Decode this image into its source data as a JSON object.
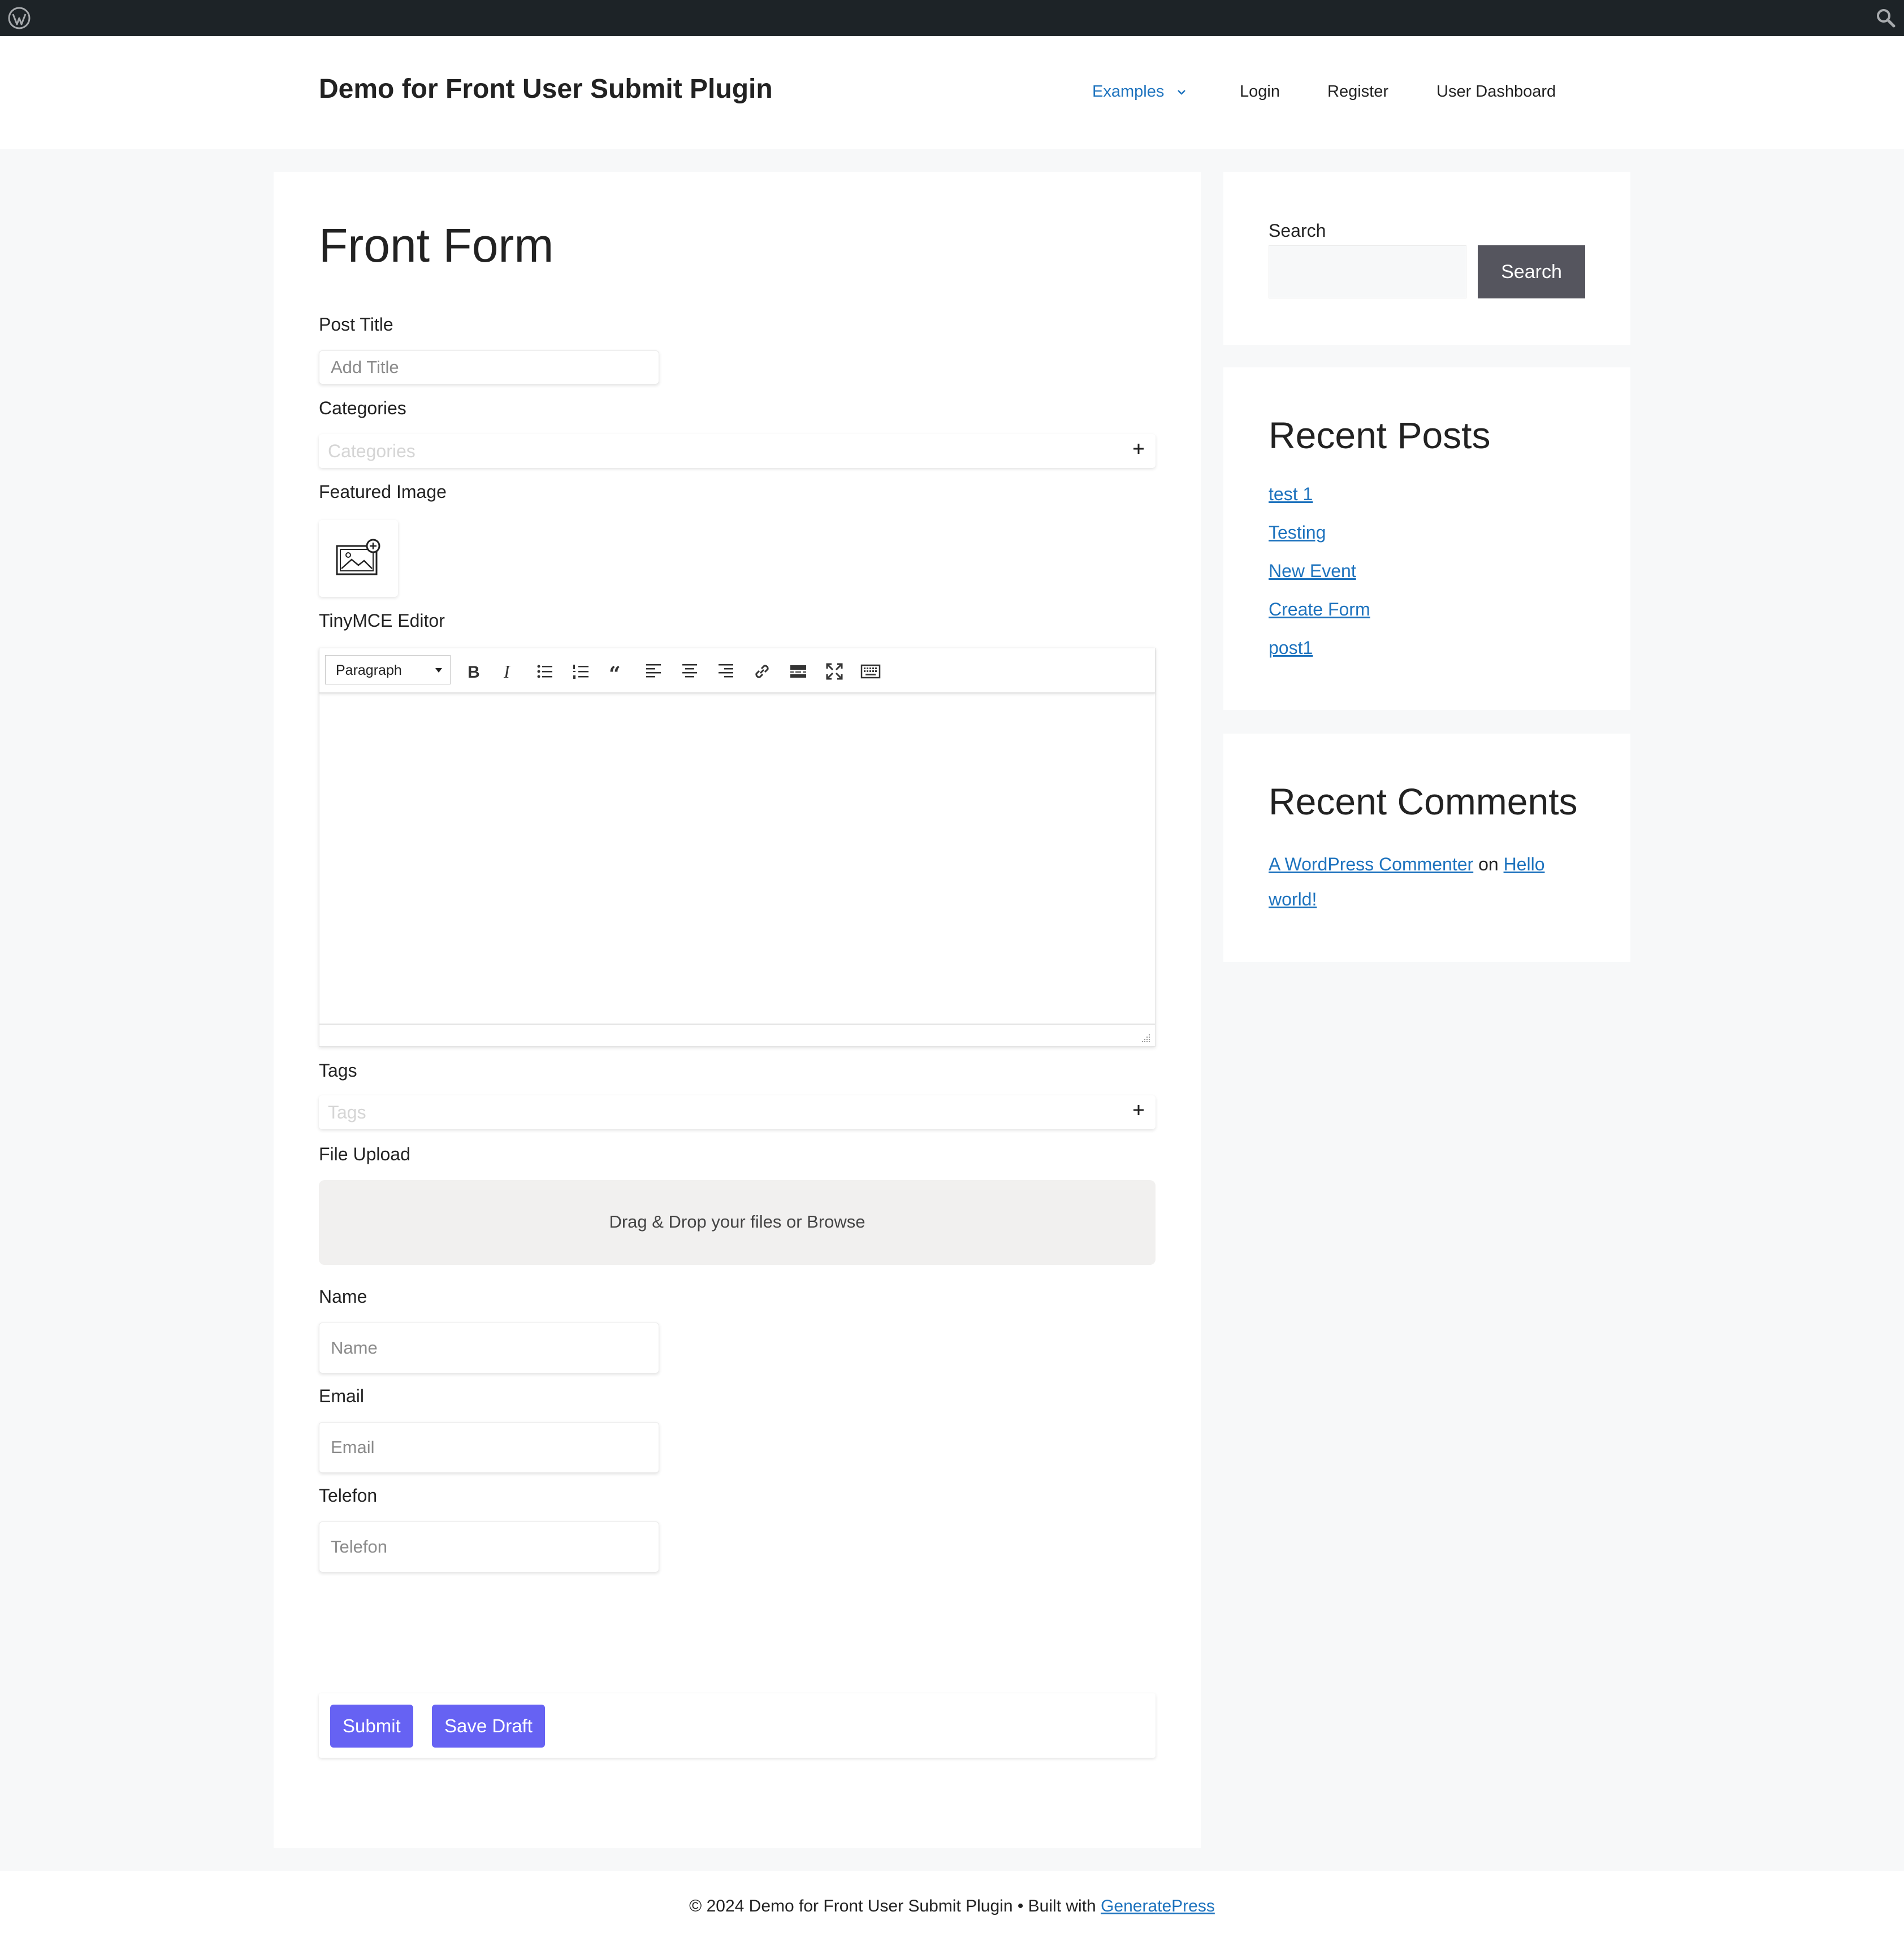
{
  "adminbar": {
    "logo_icon": "wordpress-logo-icon",
    "search_icon": "search-icon"
  },
  "site": {
    "title": "Demo for Front User Submit Plugin"
  },
  "nav": {
    "items": [
      {
        "label": "Examples",
        "current": true,
        "has_dropdown": true
      },
      {
        "label": "Login"
      },
      {
        "label": "Register"
      },
      {
        "label": "User Dashboard"
      }
    ]
  },
  "page": {
    "title": "Front Form"
  },
  "form": {
    "post_title": {
      "label": "Post Title",
      "placeholder": "Add Title"
    },
    "categories": {
      "label": "Categories",
      "placeholder": "Categories"
    },
    "featured_image": {
      "label": "Featured Image"
    },
    "editor": {
      "label": "TinyMCE Editor",
      "format_value": "Paragraph"
    },
    "tags": {
      "label": "Tags",
      "placeholder": "Tags"
    },
    "file_upload": {
      "label": "File Upload",
      "dropzone_text": "Drag & Drop your files or Browse"
    },
    "name": {
      "label": "Name",
      "placeholder": "Name"
    },
    "email": {
      "label": "Email",
      "placeholder": "Email"
    },
    "telefon": {
      "label": "Telefon",
      "placeholder": "Telefon"
    },
    "submit_label": "Submit",
    "save_draft_label": "Save Draft"
  },
  "sidebar": {
    "search": {
      "label": "Search",
      "button": "Search"
    },
    "recent_posts": {
      "title": "Recent Posts",
      "items": [
        "test 1",
        "Testing",
        "New Event",
        "Create Form",
        "post1"
      ]
    },
    "recent_comments": {
      "title": "Recent Comments",
      "author": "A WordPress Commenter",
      "on": "on",
      "post_part1": "Hello",
      "post_part2": "world!"
    }
  },
  "footer": {
    "text": "© 2024 Demo for Front User Submit Plugin • Built with",
    "link": "GeneratePress"
  },
  "colors": {
    "accent": "#1e73be",
    "button": "#6662f3",
    "adminbar": "#1d2327",
    "search_button": "#55555e"
  }
}
